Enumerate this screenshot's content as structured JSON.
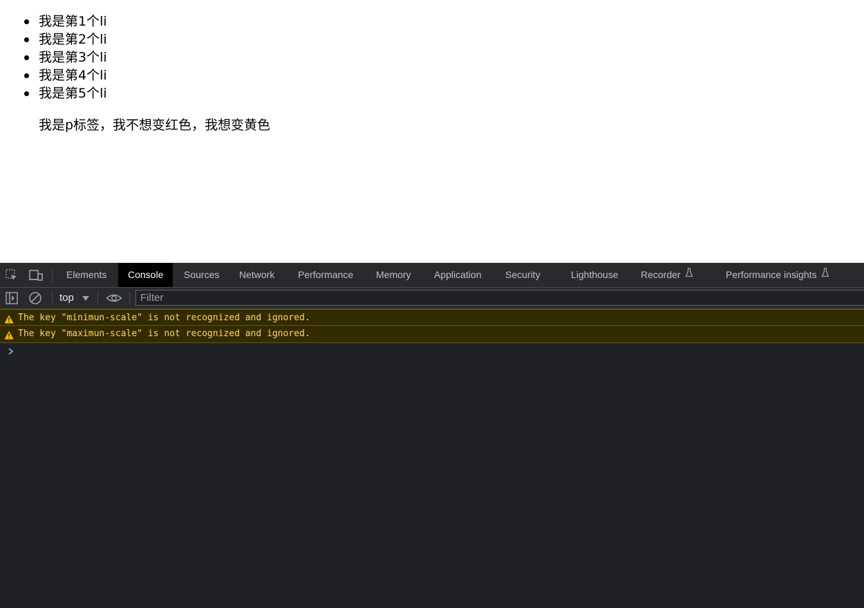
{
  "page": {
    "list_items": [
      "我是第1个li",
      "我是第2个li",
      "我是第3个li",
      "我是第4个li",
      "我是第5个li"
    ],
    "paragraph": "我是p标签，我不想变红色，我想变黄色"
  },
  "devtools": {
    "tabs": [
      {
        "label": "Elements",
        "active": false
      },
      {
        "label": "Console",
        "active": true
      },
      {
        "label": "Sources",
        "active": false
      },
      {
        "label": "Network",
        "active": false
      },
      {
        "label": "Performance",
        "active": false
      },
      {
        "label": "Memory",
        "active": false
      },
      {
        "label": "Application",
        "active": false
      },
      {
        "label": "Security",
        "active": false
      },
      {
        "label": "Lighthouse",
        "active": false
      },
      {
        "label": "Recorder",
        "active": false,
        "icon": "flask-icon"
      },
      {
        "label": "Performance insights",
        "active": false,
        "icon": "flask-icon"
      }
    ],
    "toolbar": {
      "context": "top",
      "filter_placeholder": "Filter"
    },
    "messages": [
      {
        "level": "warning",
        "text": "The key \"minimun-scale\" is not recognized and ignored."
      },
      {
        "level": "warning",
        "text": "The key \"maximun-scale\" is not recognized and ignored."
      }
    ],
    "icons": {
      "inspect": "inspect-element-icon",
      "device": "device-toolbar-icon",
      "sidebar": "show-sidebar-icon",
      "clear": "clear-console-icon",
      "live": "live-expression-eye-icon",
      "prompt": "console-prompt-chevron-icon"
    },
    "colors": {
      "panel_bg": "#202124",
      "tabbar_bg": "#292a2d",
      "active_tab_bg": "#000000",
      "warning_bg": "#332b00",
      "warning_text": "#fdd663",
      "prompt": "#8ab4f8"
    }
  }
}
